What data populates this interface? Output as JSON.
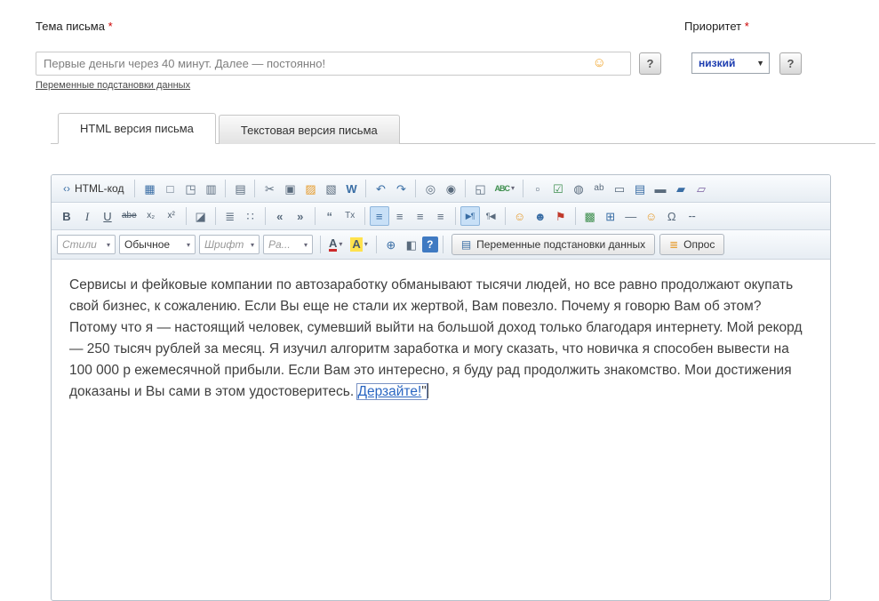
{
  "subject": {
    "label": "Тема письма",
    "required_mark": "*",
    "value": "Первые деньги через 40 минут. Далее — постоянно!",
    "substitution_link": "Переменные подстановки данных",
    "help": "?"
  },
  "priority": {
    "label": "Приоритет",
    "required_mark": "*",
    "value": "низкий",
    "help": "?"
  },
  "tabs": {
    "html": "HTML версия письма",
    "text": "Текстовая версия письма"
  },
  "editor": {
    "labels": {
      "html_code": "HTML-код",
      "spell": "ABC",
      "styles": "Стили",
      "format": "Обычное",
      "font": "Шрифт",
      "size": "Ра...",
      "vars_button": "Переменные подстановки данных",
      "survey_button": "Опрос",
      "help": "?"
    },
    "icons": {
      "html_code": "‹›",
      "save": "▦",
      "new_document": "□",
      "preview": "◳",
      "print": "▥",
      "template": "▤",
      "cut": "✂",
      "copy": "▣",
      "paste": "▨",
      "paste_text": "▧",
      "paste_word": "W",
      "undo": "↶",
      "redo": "↷",
      "find": "◎",
      "replace": "◉",
      "select_all": "◱",
      "show_blocks": "▫",
      "checkbox": "☑",
      "radio": "◍",
      "text_field": "ab",
      "textarea": "▭",
      "listbox": "▤",
      "button": "▬",
      "image_button": "▰",
      "hidden_field": "▱",
      "bold": "B",
      "italic": "I",
      "underline": "U",
      "strike": "abe",
      "subscript": "x₂",
      "superscript": "x²",
      "eraser": "◪",
      "ordered_list": "≣",
      "bullet_list": "∷",
      "outdent": "«",
      "indent": "»",
      "blockquote": "“",
      "remove_format": "Tx",
      "align": "≡",
      "ltr": "▶¶",
      "rtl": "¶◀",
      "emoticons": "☺",
      "media": "☻",
      "flag": "⚑",
      "image": "▩",
      "table": "⊞",
      "hr": "—",
      "smiley": "☺",
      "special_char": "Ω",
      "page_break": "╌",
      "forecolor": "A",
      "backcolor": "A",
      "anchor": "⊕",
      "page_props": "◧",
      "vars": "▤",
      "survey": "≣",
      "dropdown_arrow": "▾",
      "emoji": "☺",
      "select_chevron": "▼"
    },
    "content": {
      "text": "Сервисы и фейковые компании по автозаработку обманывают тысячи людей, но все равно продолжают окупать свой бизнес, к сожалению. Если Вы еще не стали их жертвой, Вам повезло. Почему я говорю Вам об этом? Потому что я — настоящий человек, сумевший выйти на большой доход только благодаря интернету. Мой рекорд — 250 тысяч рублей за месяц. Я изучил алгоритм заработка и могу сказать, что новичка я способен вывести на 100 000 р ежемесячной прибыли. Если Вам это интересно, я буду рад продолжить знакомство. Мои достижения доказаны и Вы сами в этом удостоверитесь. ",
      "link": "Дерзайте!",
      "after_link": "\""
    }
  }
}
